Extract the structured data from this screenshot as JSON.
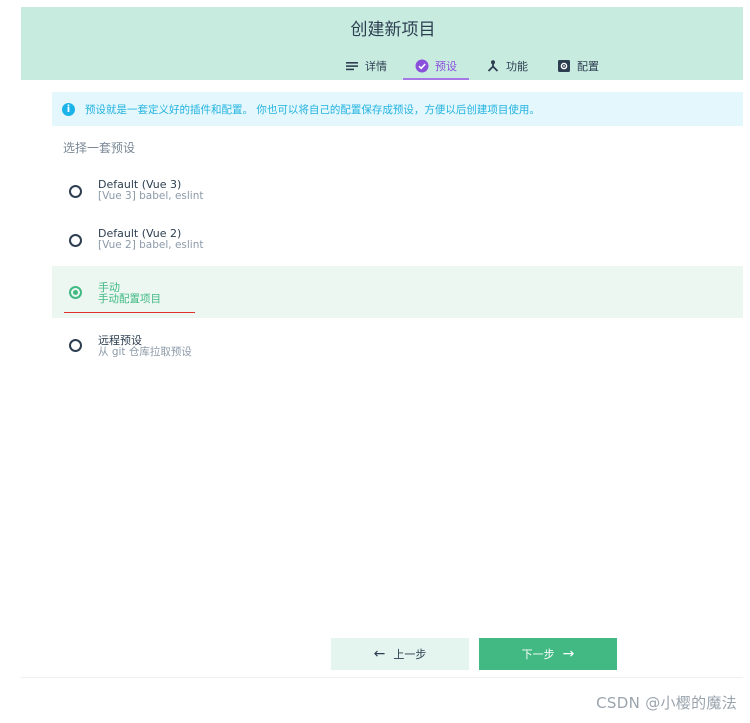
{
  "header": {
    "title": "创建新项目",
    "tabs": [
      {
        "label": "详情",
        "icon": "list-icon"
      },
      {
        "label": "预设",
        "icon": "check-circle-icon"
      },
      {
        "label": "功能",
        "icon": "split-icon"
      },
      {
        "label": "配置",
        "icon": "settings-box-icon"
      }
    ]
  },
  "info": {
    "text": "预设就是一套定义好的插件和配置。 你也可以将自己的配置保存成预设，方便以后创建项目使用。"
  },
  "section": {
    "title": "选择一套预设"
  },
  "presets": [
    {
      "name": "Default (Vue 3)",
      "desc": "[Vue 3] babel, eslint"
    },
    {
      "name": "Default (Vue 2)",
      "desc": "[Vue 2] babel, eslint"
    },
    {
      "name": "手动",
      "desc": "手动配置项目"
    },
    {
      "name": "远程预设",
      "desc": "从 git 仓库拉取预设"
    }
  ],
  "selected_preset": "手动",
  "buttons": {
    "prev": "上一步",
    "next": "下一步"
  },
  "watermark": "CSDN @小樱的魔法",
  "colors": {
    "header_bg": "#c8ebe0",
    "accent_green": "#42b983",
    "accent_purple": "#8a4fdb",
    "info_blue": "#23b3e0"
  }
}
